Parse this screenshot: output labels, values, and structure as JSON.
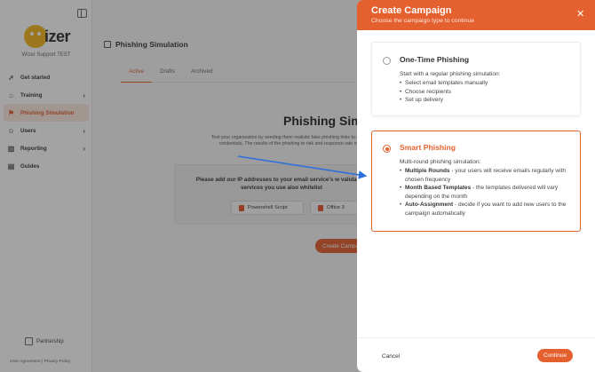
{
  "sidebar": {
    "logo_text": "izer",
    "org_name": "Wizer Support TEST",
    "items": [
      {
        "label": "Get started",
        "icon": "rocket-icon"
      },
      {
        "label": "Training",
        "icon": "graduation-cap-icon"
      },
      {
        "label": "Phishing Simulation",
        "icon": "fish-hook-icon"
      },
      {
        "label": "Users",
        "icon": "user-icon"
      },
      {
        "label": "Reporting",
        "icon": "chart-icon"
      },
      {
        "label": "Guides",
        "icon": "book-icon"
      }
    ],
    "partnership_label": "Partnership",
    "footer_links": "User Agreement  |  Privacy Policy"
  },
  "main": {
    "page_heading": "Phishing Simulation",
    "tabs": [
      {
        "label": "Active"
      },
      {
        "label": "Drafts"
      },
      {
        "label": "Archived"
      }
    ],
    "title": "Phishing Sim",
    "description": "Test your organization by sending them realistic fake phishing links to give up their credentials. The results of the phishing te risk and response rate of learner",
    "ip_notice": "Please add our IP addresses to your email service's w validation services you use also whitelist",
    "powershell_label": "Powershell Script",
    "office_label": "Office 3",
    "create_label": "Create Campa"
  },
  "drawer": {
    "title": "Create Campaign",
    "subtitle": "Choose the campaign type to continue",
    "close_glyph": "✕",
    "options": [
      {
        "title": "One-Time Phishing",
        "intro": "Start with a regular phishing simulation:",
        "items": [
          "Select email templates manually",
          "Choose recipients",
          "Set up delivery"
        ]
      },
      {
        "title": "Smart Phishing",
        "intro": "Multi-round phishing simulation:",
        "items": [
          {
            "bold": "Multiple Rounds",
            "text": " - your users will receive emails regularly with chosen frequency"
          },
          {
            "bold": "Month Based Templates",
            "text": " - the templates delivered will vary depending on the month"
          },
          {
            "bold": "Auto-Assignment",
            "text": " - decide if you want to add new users to the campaign automatically"
          }
        ]
      }
    ],
    "selected_option": "Smart Phishing",
    "cancel_label": "Cancel",
    "continue_label": "Continue"
  },
  "colors": {
    "accent": "#e5602f",
    "arrow": "#2f6fdc",
    "overlay": "rgba(35,35,35,0.42)"
  }
}
